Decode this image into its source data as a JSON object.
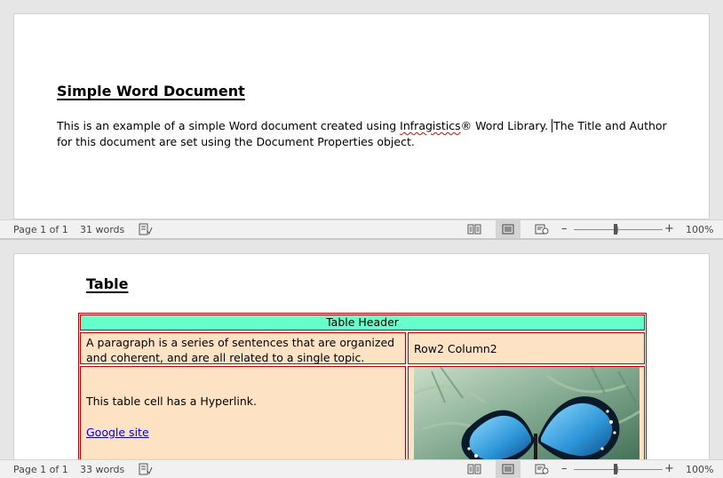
{
  "pane1": {
    "title": "Simple Word Document",
    "body_before": "This is an example of a simple Word document created using ",
    "body_brand": "Infragistics",
    "body_mid": "® Word Library. ",
    "body_after": "The Title and Author for this document are set using the Document Properties object.",
    "status": {
      "page": "Page 1 of 1",
      "words": "31 words",
      "zoom": "100%"
    }
  },
  "pane2": {
    "title": "Table",
    "table": {
      "header": "Table Header",
      "row2_col1": "A paragraph is a series of sentences that are organized and coherent, and are all related to a single topic.",
      "row2_col2": "Row2 Column2",
      "row3_col1_text": "This table cell has a Hyperlink.",
      "row3_col1_link": "Google site"
    },
    "status": {
      "page": "Page 1 of 1",
      "words": "33 words",
      "zoom": "100%"
    }
  },
  "colors": {
    "table_border": "#c00000",
    "header_fill": "#66ffcc",
    "cell_fill": "#fde3c4",
    "link": "#0000ee"
  },
  "icons": [
    "proofing-icon",
    "read-mode-icon",
    "print-layout-icon",
    "web-layout-icon",
    "zoom-minus-icon",
    "zoom-plus-icon",
    "butterfly-image"
  ]
}
